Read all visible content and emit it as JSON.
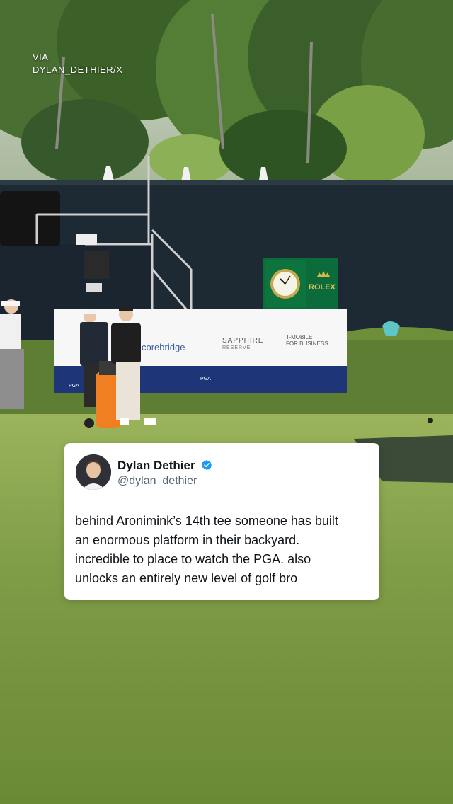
{
  "credit": {
    "line1": "VIA",
    "line2": "DYLAN_DETHIER/X"
  },
  "signage": {
    "clock_brand": "ROLEX",
    "sponsor_1": "corebridge",
    "sponsor_2": "SAPPHIRE",
    "sponsor_2_sub": "RESERVE",
    "sponsor_3_line1": "T-MOBILE",
    "sponsor_3_line2": "FOR BUSINESS",
    "pga_label": "PGA"
  },
  "tweet": {
    "author_name": "Dylan Dethier",
    "author_handle": "@dylan_dethier",
    "verified": true,
    "text_lines": [
      "behind Aronimink’s 14th tee someone has built",
      "an enormous platform in their backyard.",
      "incredible to place to watch the PGA. also",
      "unlocks an entirely new level of golf bro"
    ]
  },
  "colors": {
    "verified_blue": "#1d9bf0",
    "rolex_green": "#0b6b3a",
    "turf": "#7b9a45",
    "fence": "#1d2a33"
  }
}
